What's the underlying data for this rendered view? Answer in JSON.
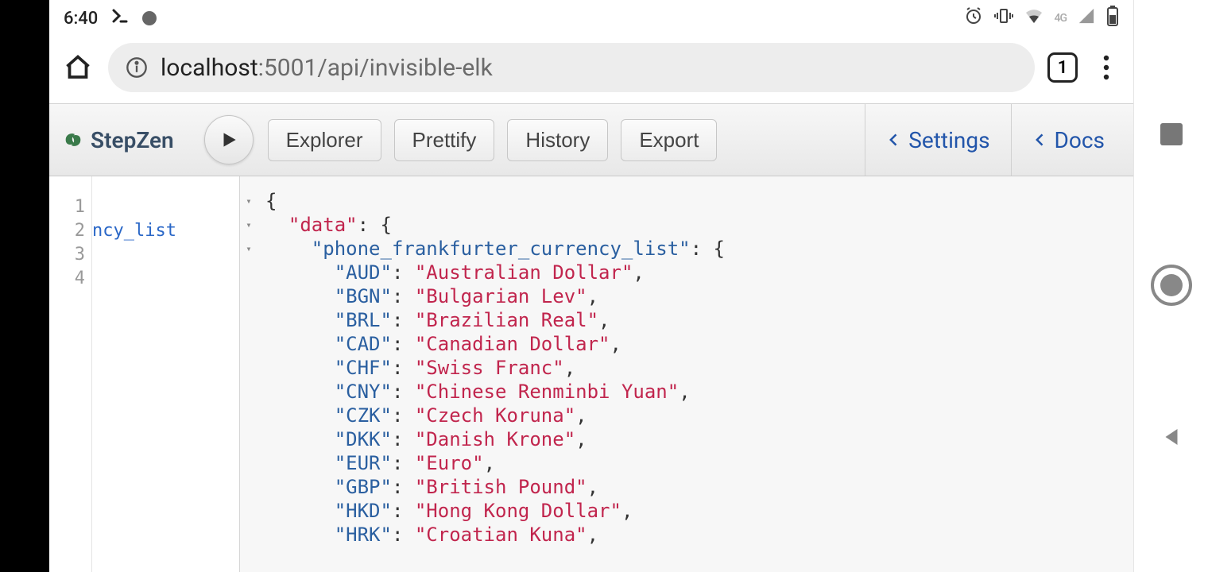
{
  "status_bar": {
    "time": "6:40",
    "icons": {
      "terminal": "terminal",
      "dot": "dot",
      "alarm": "alarm",
      "vibrate": "vibrate",
      "wifi": "wifi",
      "network_label": "4G",
      "signal": "signal",
      "battery": "battery"
    }
  },
  "browser": {
    "url_host": "localhost",
    "url_path": ":5001/api/invisible-elk",
    "tab_count": "1"
  },
  "toolbar": {
    "logo": "StepZen",
    "buttons": {
      "explorer": "Explorer",
      "prettify": "Prettify",
      "history": "History",
      "export": "Export"
    },
    "links": {
      "settings": "Settings",
      "docs": "Docs"
    }
  },
  "query_pane": {
    "line_numbers": [
      "1",
      "2",
      "3",
      "4"
    ],
    "visible_fragment": "ncy_list"
  },
  "result": {
    "root_key": "data",
    "inner_key": "phone_frankfurter_currency_list",
    "entries": [
      {
        "k": "AUD",
        "v": "Australian Dollar"
      },
      {
        "k": "BGN",
        "v": "Bulgarian Lev"
      },
      {
        "k": "BRL",
        "v": "Brazilian Real"
      },
      {
        "k": "CAD",
        "v": "Canadian Dollar"
      },
      {
        "k": "CHF",
        "v": "Swiss Franc"
      },
      {
        "k": "CNY",
        "v": "Chinese Renminbi Yuan"
      },
      {
        "k": "CZK",
        "v": "Czech Koruna"
      },
      {
        "k": "DKK",
        "v": "Danish Krone"
      },
      {
        "k": "EUR",
        "v": "Euro"
      },
      {
        "k": "GBP",
        "v": "British Pound"
      },
      {
        "k": "HKD",
        "v": "Hong Kong Dollar"
      },
      {
        "k": "HRK",
        "v": "Croatian Kuna"
      }
    ]
  }
}
